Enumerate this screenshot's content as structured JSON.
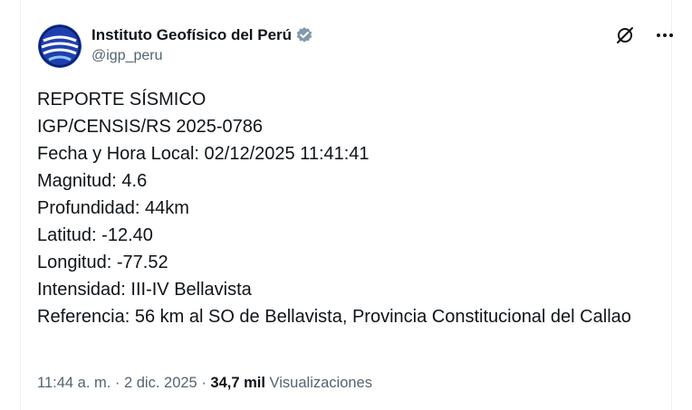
{
  "author": {
    "display_name": "Instituto Geofísico del Perú",
    "handle": "@igp_peru",
    "verified_badge_icon": "verified-badge-icon",
    "avatar_icon": "igp-logo-icon",
    "accent_color": "#1d4ed8"
  },
  "actions": {
    "grok_icon": "grok-icon",
    "more_icon": "more-horizontal-icon"
  },
  "body": {
    "lines": [
      "REPORTE SÍSMICO",
      "IGP/CENSIS/RS 2025-0786",
      "Fecha y Hora Local: 02/12/2025 11:41:41",
      "Magnitud: 4.6",
      "Profundidad: 44km",
      "Latitud: -12.40",
      "Longitud: -77.52",
      "Intensidad: III-IV Bellavista",
      "Referencia: 56 km al SO de Bellavista, Provincia Constitucional del Callao"
    ]
  },
  "meta": {
    "time": "11:44 a. m.",
    "separator": " · ",
    "date": "2 dic. 2025",
    "views_count": "34,7 mil",
    "views_label": "Visualizaciones"
  }
}
